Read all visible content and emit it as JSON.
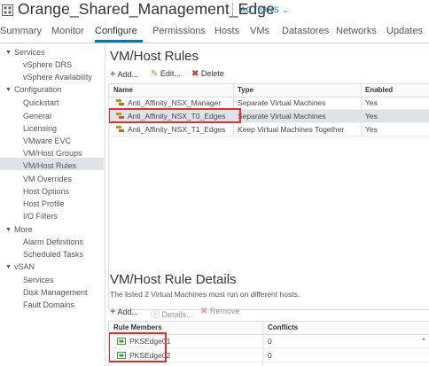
{
  "header": {
    "title": "Orange_Shared_Management_Edge",
    "actions_label": "ACTIONS ⌄"
  },
  "tabs": [
    {
      "label": "Summary"
    },
    {
      "label": "Monitor"
    },
    {
      "label": "Configure"
    },
    {
      "label": "Permissions"
    },
    {
      "label": "Hosts"
    },
    {
      "label": "VMs"
    },
    {
      "label": "Datastores"
    },
    {
      "label": "Networks"
    },
    {
      "label": "Updates"
    }
  ],
  "sidebar": {
    "items": [
      {
        "label": "Services"
      },
      {
        "label": "vSphere DRS"
      },
      {
        "label": "vSphere Availability"
      },
      {
        "label": "Configuration"
      },
      {
        "label": "Quickstart"
      },
      {
        "label": "General"
      },
      {
        "label": "Licensing"
      },
      {
        "label": "VMware EVC"
      },
      {
        "label": "VM/Host Groups"
      },
      {
        "label": "VM/Host Rules"
      },
      {
        "label": "VM Overrides"
      },
      {
        "label": "Host Options"
      },
      {
        "label": "Host Profile"
      },
      {
        "label": "I/O Filters"
      },
      {
        "label": "More"
      },
      {
        "label": "Alarm Definitions"
      },
      {
        "label": "Scheduled Tasks"
      },
      {
        "label": "vSAN"
      },
      {
        "label": "Services"
      },
      {
        "label": "Disk Management"
      },
      {
        "label": "Fault Domains"
      }
    ]
  },
  "rules": {
    "heading": "VM/Host Rules",
    "toolbar": {
      "add": "Add...",
      "edit": "Edit...",
      "delete": "Delete"
    },
    "columns": [
      "Name",
      "Type",
      "Enabled"
    ],
    "rows": [
      {
        "name": "Anti_Affinity_NSX_Manager",
        "type": "Separate Virtual Machines",
        "enabled": "Yes"
      },
      {
        "name": "Anti_Affinity_NSX_T0_Edges",
        "type": "Separate Virtual Machines",
        "enabled": "Yes"
      },
      {
        "name": "Anti_Affinity_NSX_T1_Edges",
        "type": "Keep Virtual Machines Together",
        "enabled": "Yes"
      }
    ]
  },
  "details": {
    "heading": "VM/Host Rule Details",
    "description": "The listed 2 Virtual Machines must run on different hosts.",
    "toolbar": {
      "add": "Add...",
      "details": "Details...",
      "remove": "Remove"
    },
    "columns": [
      "Rule Members",
      "Conflicts"
    ],
    "rows": [
      {
        "member": "PKSEdge01",
        "conflicts": "0"
      },
      {
        "member": "PKSEdge02",
        "conflicts": "0"
      }
    ]
  },
  "colors": {
    "accent": "#0079b8",
    "highlight": "#d93030",
    "selected_bg": "#dfe3e7",
    "add_green": "#3c9b3c",
    "delete_red": "#d62c2c"
  }
}
